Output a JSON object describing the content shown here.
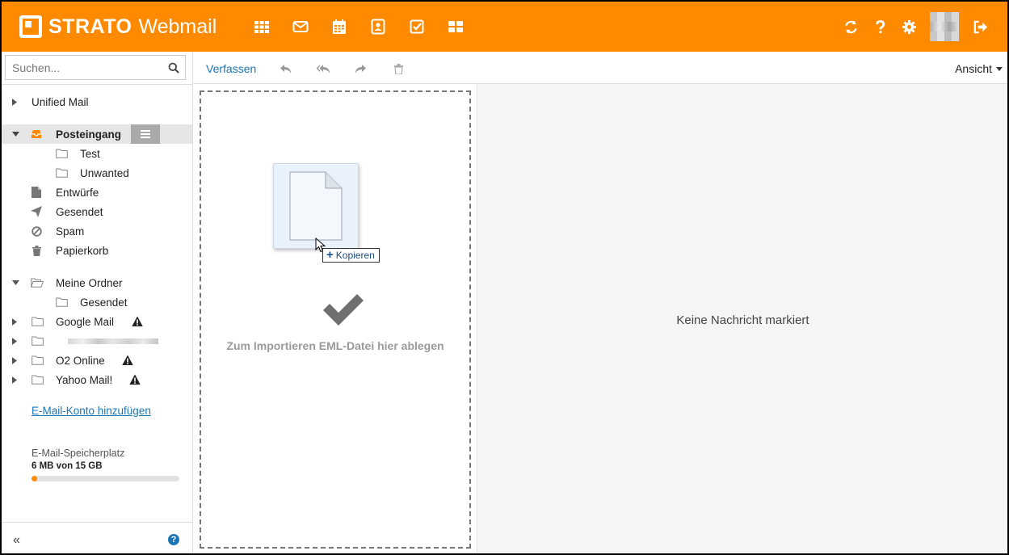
{
  "header": {
    "brand": "STRATO",
    "app": "Webmail",
    "apps": [
      {
        "name": "apps-grid-icon"
      },
      {
        "name": "mail-icon"
      },
      {
        "name": "calendar-icon"
      },
      {
        "name": "contacts-icon"
      },
      {
        "name": "tasks-icon"
      },
      {
        "name": "portal-icon"
      }
    ],
    "right": [
      "refresh-icon",
      "help-icon",
      "settings-icon",
      "avatar",
      "logout-icon"
    ],
    "color": "#ff8a00"
  },
  "search": {
    "placeholder": "Suchen..."
  },
  "folders": {
    "unified": "Unified Mail",
    "inbox": "Posteingang",
    "inbox_children": [
      "Test",
      "Unwanted"
    ],
    "drafts": "Entwürfe",
    "sent": "Gesendet",
    "spam": "Spam",
    "trash": "Papierkorb",
    "my_folders": "Meine Ordner",
    "my_folders_children": [
      "Gesendet"
    ],
    "accounts": [
      "Google Mail",
      "",
      "O2 Online",
      "Yahoo Mail!"
    ]
  },
  "sidebar": {
    "add_account": "E-Mail-Konto hinzufügen",
    "storage_label": "E-Mail-Speicherplatz",
    "storage_value": "6 MB von 15 GB",
    "storage_fraction": 0.04,
    "collapse": "«",
    "help": "?"
  },
  "toolbar": {
    "compose": "Verfassen",
    "view": "Ansicht"
  },
  "dropzone": {
    "tooltip": "Kopieren",
    "tooltip_plus": "+",
    "text": "Zum Importieren EML-Datei hier ablegen"
  },
  "detail": {
    "empty": "Keine Nachricht markiert"
  }
}
